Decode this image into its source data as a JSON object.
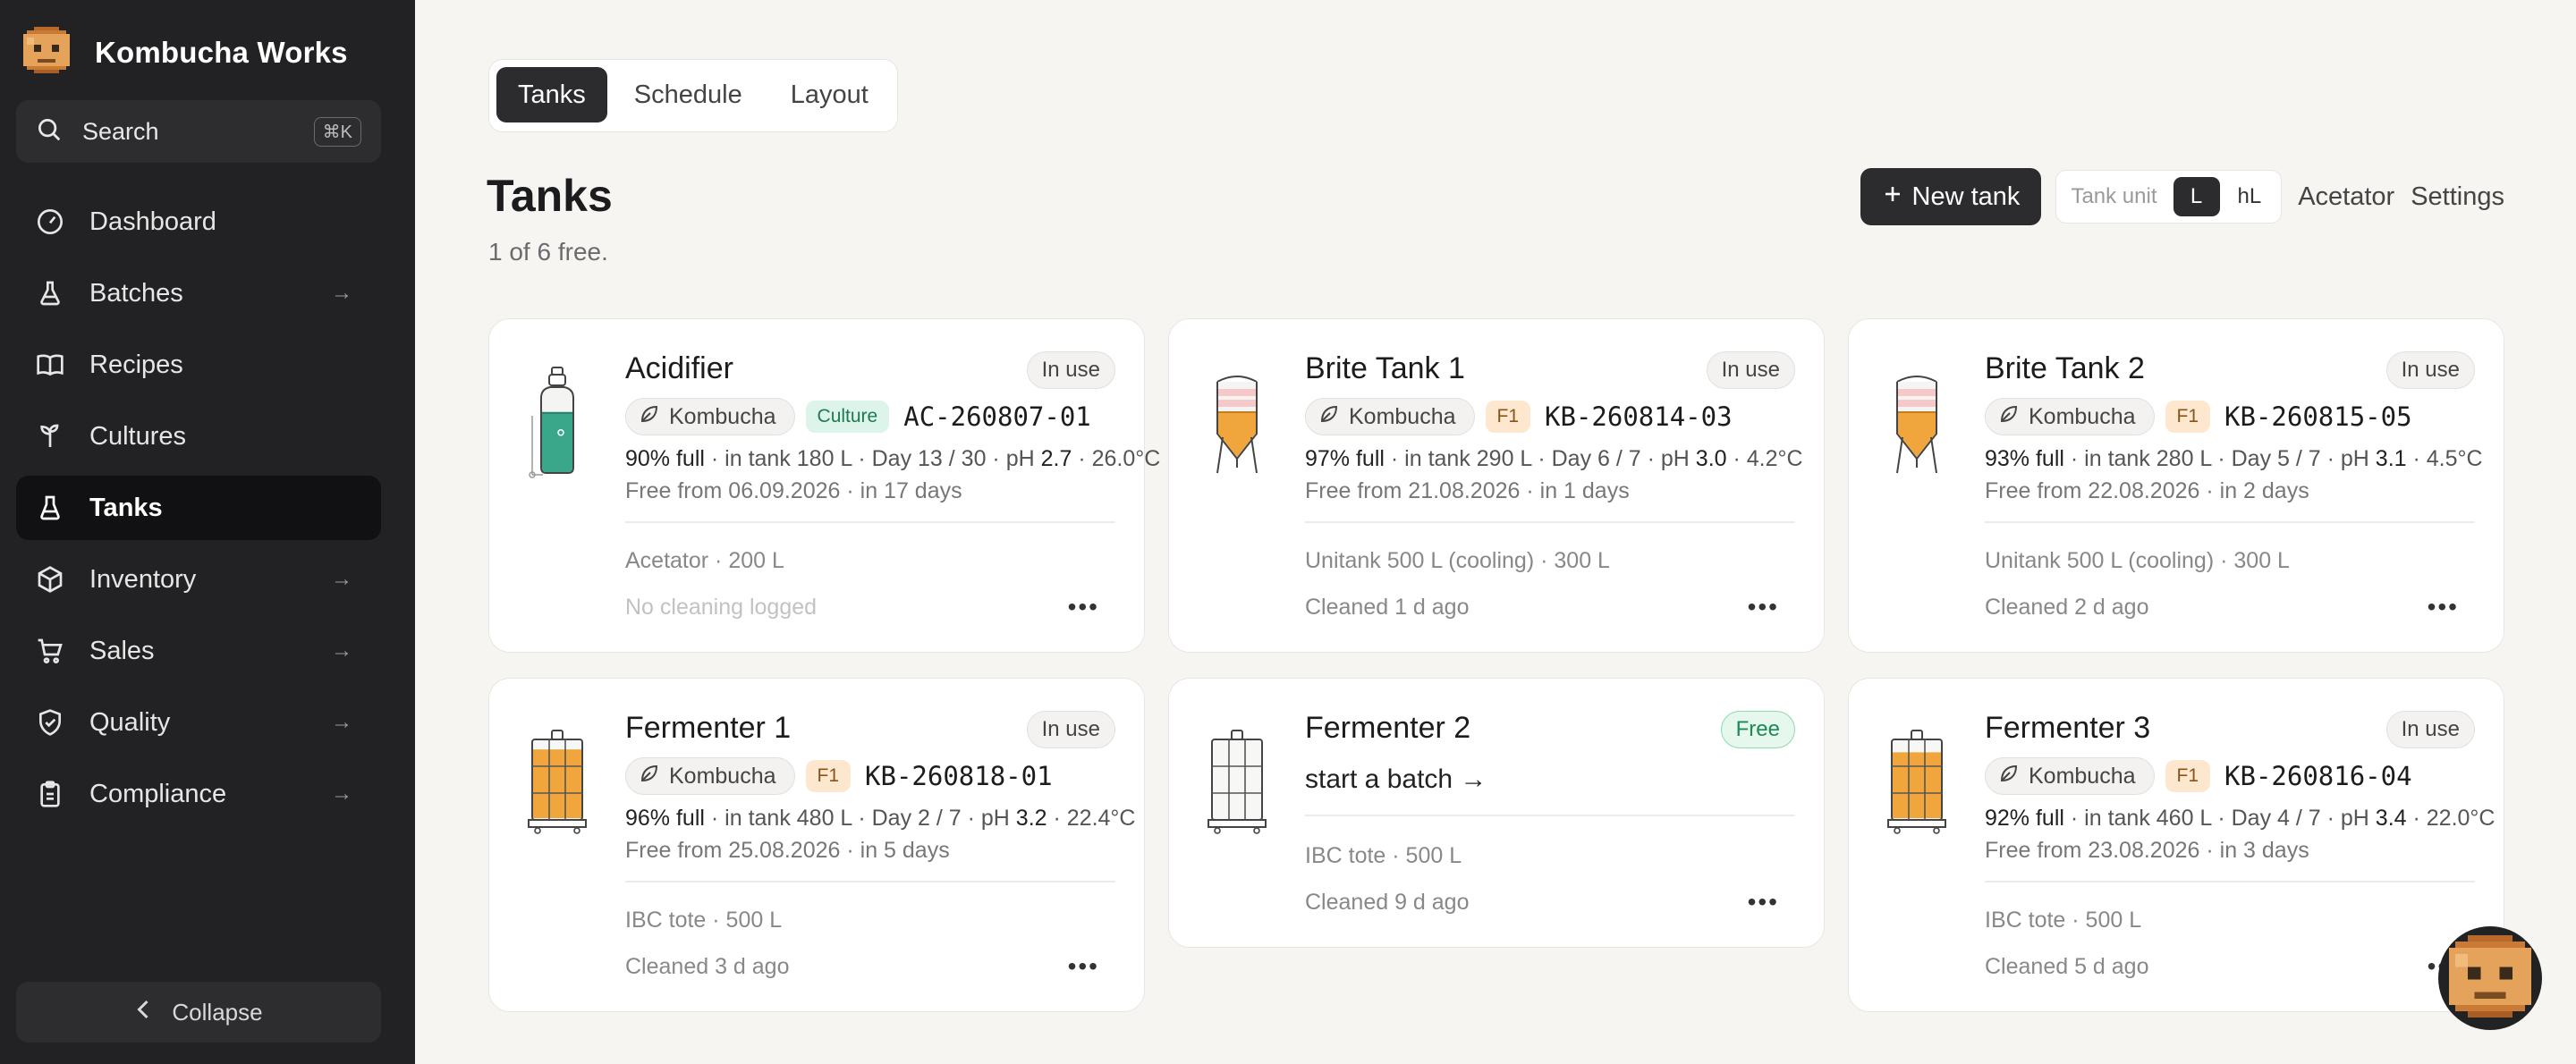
{
  "app": {
    "name": "Kombucha Works"
  },
  "search": {
    "label": "Search",
    "shortcut": "⌘K"
  },
  "nav": [
    {
      "label": "Dashboard",
      "icon": "gauge-icon",
      "arrow": ""
    },
    {
      "label": "Batches",
      "icon": "flask-icon",
      "arrow": "→"
    },
    {
      "label": "Recipes",
      "icon": "book-icon",
      "arrow": ""
    },
    {
      "label": "Cultures",
      "icon": "sprout-icon",
      "arrow": ""
    },
    {
      "label": "Tanks",
      "icon": "beaker-icon",
      "arrow": "",
      "active": true
    },
    {
      "label": "Inventory",
      "icon": "box-icon",
      "arrow": "→"
    },
    {
      "label": "Sales",
      "icon": "cart-icon",
      "arrow": "→"
    },
    {
      "label": "Quality",
      "icon": "shield-check-icon",
      "arrow": "→"
    },
    {
      "label": "Compliance",
      "icon": "clipboard-icon",
      "arrow": "→"
    }
  ],
  "collapse": {
    "label": "Collapse"
  },
  "tabs": [
    {
      "label": "Tanks",
      "active": true
    },
    {
      "label": "Schedule"
    },
    {
      "label": "Layout"
    }
  ],
  "page": {
    "title": "Tanks",
    "subtitle": "1 of 6 free."
  },
  "toolbar": {
    "new_tank": "New tank",
    "unit_label": "Tank unit",
    "units": [
      "L",
      "hL"
    ],
    "selected_unit": "L",
    "acetator": "Acetator",
    "settings": "Settings"
  },
  "cards": [
    {
      "title": "Acidifier",
      "status": "In use",
      "illustration": "acetator-bottle",
      "chip": "Kombucha",
      "badge": "Culture",
      "code": "AC-260807-01",
      "fill": "90% full",
      "in_tank": " · in tank 180 L · Day 13 / 30 · pH ",
      "ph": "2.7",
      "temp": " · 26.0°C",
      "free_from": "Free from 06.09.2026 · in 17 days",
      "vessel": "Acetator · 200 L",
      "cleaning": "No cleaning logged",
      "cleaning_faint": true,
      "fill_level": 0.9,
      "liquid_color": "#3aa68a"
    },
    {
      "title": "Brite Tank 1",
      "status": "In use",
      "illustration": "unitank",
      "chip": "Kombucha",
      "badge": "F1",
      "code": "KB-260814-03",
      "fill": "97% full",
      "in_tank": " · in tank 290 L · Day 6 / 7 · pH ",
      "ph": "3.0",
      "temp": " · 4.2°C",
      "free_from": "Free from 21.08.2026 · in 1 days",
      "vessel": "Unitank 500 L (cooling) · 300 L",
      "cleaning": "Cleaned 1 d ago",
      "fill_level": 0.97,
      "liquid_color": "#f0a63c"
    },
    {
      "title": "Brite Tank 2",
      "status": "In use",
      "illustration": "unitank",
      "chip": "Kombucha",
      "badge": "F1",
      "code": "KB-260815-05",
      "fill": "93% full",
      "in_tank": " · in tank 280 L · Day 5 / 7 · pH ",
      "ph": "3.1",
      "temp": " · 4.5°C",
      "free_from": "Free from 22.08.2026 · in 2 days",
      "vessel": "Unitank 500 L (cooling) · 300 L",
      "cleaning": "Cleaned 2 d ago",
      "fill_level": 0.93,
      "liquid_color": "#f0a63c"
    },
    {
      "title": "Fermenter 1",
      "status": "In use",
      "illustration": "ibc-tote",
      "chip": "Kombucha",
      "badge": "F1",
      "code": "KB-260818-01",
      "fill": "96% full",
      "in_tank": " · in tank 480 L · Day 2 / 7 · pH ",
      "ph": "3.2",
      "temp": " · 22.4°C",
      "free_from": "Free from 25.08.2026 · in 5 days",
      "vessel": "IBC tote · 500 L",
      "cleaning": "Cleaned 3 d ago",
      "fill_level": 0.96,
      "liquid_color": "#f0a63c"
    },
    {
      "title": "Fermenter 2",
      "status": "Free",
      "illustration": "ibc-tote",
      "start": "start a batch →",
      "vessel": "IBC tote · 500 L",
      "cleaning": "Cleaned 9 d ago",
      "fill_level": 0,
      "liquid_color": "#f0a63c"
    },
    {
      "title": "Fermenter 3",
      "status": "In use",
      "illustration": "ibc-tote",
      "chip": "Kombucha",
      "badge": "F1",
      "code": "KB-260816-04",
      "fill": "92% full",
      "in_tank": " · in tank 460 L · Day 4 / 7 · pH ",
      "ph": "3.4",
      "temp": " · 22.0°C",
      "free_from": "Free from 23.08.2026 · in 3 days",
      "vessel": "IBC tote · 500 L",
      "cleaning": "Cleaned 5 d ago",
      "fill_level": 0.92,
      "liquid_color": "#f0a63c"
    }
  ],
  "more_label": "•••",
  "colors": {
    "sidebar": "#222224",
    "accent_dark": "#2c2c2e",
    "free_green": "#1c8a55",
    "liquid_orange": "#f0a63c",
    "liquid_teal": "#3aa68a"
  }
}
